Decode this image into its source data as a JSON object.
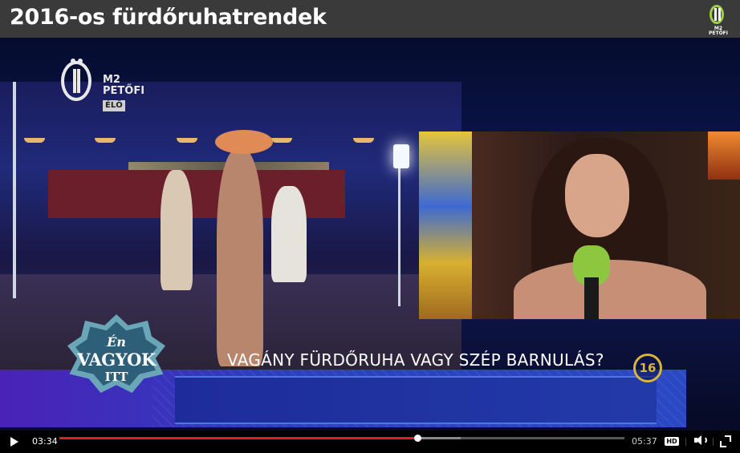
{
  "page": {
    "title": "2016-os fürdőruhatrendek",
    "corner_logo_text": "M2 PETŐFI"
  },
  "video": {
    "channel": {
      "name": "M2\nPETŐFI",
      "live_badge": "ÉLŐ"
    },
    "show_logo": {
      "line1": "Én",
      "line2": "VAGYOK",
      "line3": "ITT"
    },
    "headline": "VAGÁNY FÜRDŐRUHA VAGY SZÉP BARNULÁS?",
    "age_rating": "16"
  },
  "controls": {
    "current_time": "03:34",
    "total_time": "05:37",
    "progress_percent": 63.4,
    "buffered_percent": 71,
    "hd_label": "HD",
    "icons": [
      "play-icon",
      "hd-icon",
      "volume-icon",
      "fullscreen-icon"
    ]
  },
  "colors": {
    "title_bar": "#3a3a3a",
    "progress_played": "#e02020",
    "lower_third": "#2b48c4",
    "rating_ring": "#d8b43a",
    "logo_green": "#9ed04b"
  }
}
